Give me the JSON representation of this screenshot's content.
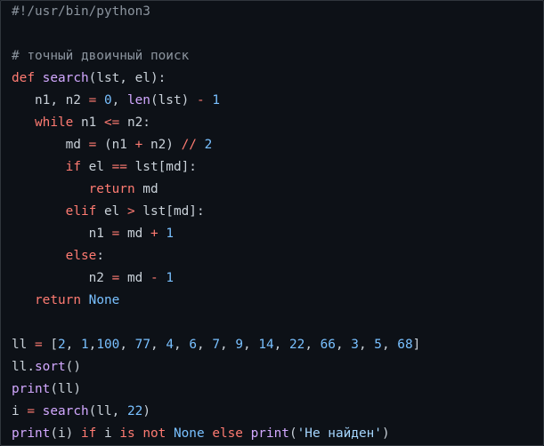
{
  "editor": {
    "language": "python",
    "colors": {
      "background": "#0d1117",
      "text": "#c9d1d9",
      "comment": "#8b949e",
      "keyword": "#ff7b72",
      "function": "#d2a8ff",
      "number": "#79c0ff",
      "string": "#a5d6ff"
    },
    "lines": [
      {
        "tokens": [
          {
            "t": "comment",
            "v": "#!/usr/bin/python3"
          }
        ]
      },
      {
        "tokens": []
      },
      {
        "tokens": [
          {
            "t": "comment",
            "v": "# точный двоичный поиск"
          }
        ]
      },
      {
        "tokens": [
          {
            "t": "keyword",
            "v": "def"
          },
          {
            "t": "text",
            "v": " "
          },
          {
            "t": "func",
            "v": "search"
          },
          {
            "t": "text",
            "v": "(lst, el):"
          }
        ]
      },
      {
        "tokens": [
          {
            "t": "text",
            "v": "   n1, n2 "
          },
          {
            "t": "op",
            "v": "="
          },
          {
            "t": "text",
            "v": " "
          },
          {
            "t": "number",
            "v": "0"
          },
          {
            "t": "text",
            "v": ", "
          },
          {
            "t": "builtin",
            "v": "len"
          },
          {
            "t": "text",
            "v": "(lst) "
          },
          {
            "t": "op",
            "v": "-"
          },
          {
            "t": "text",
            "v": " "
          },
          {
            "t": "number",
            "v": "1"
          }
        ]
      },
      {
        "tokens": [
          {
            "t": "text",
            "v": "   "
          },
          {
            "t": "keyword",
            "v": "while"
          },
          {
            "t": "text",
            "v": " n1 "
          },
          {
            "t": "op",
            "v": "<="
          },
          {
            "t": "text",
            "v": " n2:"
          }
        ]
      },
      {
        "tokens": [
          {
            "t": "text",
            "v": "       md "
          },
          {
            "t": "op",
            "v": "="
          },
          {
            "t": "text",
            "v": " (n1 "
          },
          {
            "t": "op",
            "v": "+"
          },
          {
            "t": "text",
            "v": " n2) "
          },
          {
            "t": "op",
            "v": "//"
          },
          {
            "t": "text",
            "v": " "
          },
          {
            "t": "number",
            "v": "2"
          }
        ]
      },
      {
        "tokens": [
          {
            "t": "text",
            "v": "       "
          },
          {
            "t": "keyword",
            "v": "if"
          },
          {
            "t": "text",
            "v": " el "
          },
          {
            "t": "op",
            "v": "=="
          },
          {
            "t": "text",
            "v": " lst[md]:"
          }
        ]
      },
      {
        "tokens": [
          {
            "t": "text",
            "v": "          "
          },
          {
            "t": "keyword",
            "v": "return"
          },
          {
            "t": "text",
            "v": " md"
          }
        ]
      },
      {
        "tokens": [
          {
            "t": "text",
            "v": "       "
          },
          {
            "t": "keyword",
            "v": "elif"
          },
          {
            "t": "text",
            "v": " el "
          },
          {
            "t": "op",
            "v": ">"
          },
          {
            "t": "text",
            "v": " lst[md]:"
          }
        ]
      },
      {
        "tokens": [
          {
            "t": "text",
            "v": "          n1 "
          },
          {
            "t": "op",
            "v": "="
          },
          {
            "t": "text",
            "v": " md "
          },
          {
            "t": "op",
            "v": "+"
          },
          {
            "t": "text",
            "v": " "
          },
          {
            "t": "number",
            "v": "1"
          }
        ]
      },
      {
        "tokens": [
          {
            "t": "text",
            "v": "       "
          },
          {
            "t": "keyword",
            "v": "else"
          },
          {
            "t": "text",
            "v": ":"
          }
        ]
      },
      {
        "tokens": [
          {
            "t": "text",
            "v": "          n2 "
          },
          {
            "t": "op",
            "v": "="
          },
          {
            "t": "text",
            "v": " md "
          },
          {
            "t": "op",
            "v": "-"
          },
          {
            "t": "text",
            "v": " "
          },
          {
            "t": "number",
            "v": "1"
          }
        ]
      },
      {
        "tokens": [
          {
            "t": "text",
            "v": "   "
          },
          {
            "t": "keyword",
            "v": "return"
          },
          {
            "t": "text",
            "v": " "
          },
          {
            "t": "const",
            "v": "None"
          }
        ]
      },
      {
        "tokens": []
      },
      {
        "tokens": [
          {
            "t": "text",
            "v": "ll "
          },
          {
            "t": "op",
            "v": "="
          },
          {
            "t": "text",
            "v": " ["
          },
          {
            "t": "number",
            "v": "2"
          },
          {
            "t": "text",
            "v": ", "
          },
          {
            "t": "number",
            "v": "1"
          },
          {
            "t": "text",
            "v": ","
          },
          {
            "t": "number",
            "v": "100"
          },
          {
            "t": "text",
            "v": ", "
          },
          {
            "t": "number",
            "v": "77"
          },
          {
            "t": "text",
            "v": ", "
          },
          {
            "t": "number",
            "v": "4"
          },
          {
            "t": "text",
            "v": ", "
          },
          {
            "t": "number",
            "v": "6"
          },
          {
            "t": "text",
            "v": ", "
          },
          {
            "t": "number",
            "v": "7"
          },
          {
            "t": "text",
            "v": ", "
          },
          {
            "t": "number",
            "v": "9"
          },
          {
            "t": "text",
            "v": ", "
          },
          {
            "t": "number",
            "v": "14"
          },
          {
            "t": "text",
            "v": ", "
          },
          {
            "t": "number",
            "v": "22"
          },
          {
            "t": "text",
            "v": ", "
          },
          {
            "t": "number",
            "v": "66"
          },
          {
            "t": "text",
            "v": ", "
          },
          {
            "t": "number",
            "v": "3"
          },
          {
            "t": "text",
            "v": ", "
          },
          {
            "t": "number",
            "v": "5"
          },
          {
            "t": "text",
            "v": ", "
          },
          {
            "t": "number",
            "v": "68"
          },
          {
            "t": "text",
            "v": "]"
          }
        ]
      },
      {
        "tokens": [
          {
            "t": "text",
            "v": "ll."
          },
          {
            "t": "func",
            "v": "sort"
          },
          {
            "t": "text",
            "v": "()"
          }
        ]
      },
      {
        "tokens": [
          {
            "t": "builtin",
            "v": "print"
          },
          {
            "t": "text",
            "v": "(ll)"
          }
        ]
      },
      {
        "tokens": [
          {
            "t": "text",
            "v": "i "
          },
          {
            "t": "op",
            "v": "="
          },
          {
            "t": "text",
            "v": " "
          },
          {
            "t": "func",
            "v": "search"
          },
          {
            "t": "text",
            "v": "(ll, "
          },
          {
            "t": "number",
            "v": "22"
          },
          {
            "t": "text",
            "v": ")"
          }
        ]
      },
      {
        "tokens": [
          {
            "t": "builtin",
            "v": "print"
          },
          {
            "t": "text",
            "v": "(i) "
          },
          {
            "t": "keyword",
            "v": "if"
          },
          {
            "t": "text",
            "v": " i "
          },
          {
            "t": "keyword",
            "v": "is"
          },
          {
            "t": "text",
            "v": " "
          },
          {
            "t": "keyword",
            "v": "not"
          },
          {
            "t": "text",
            "v": " "
          },
          {
            "t": "const",
            "v": "None"
          },
          {
            "t": "text",
            "v": " "
          },
          {
            "t": "keyword",
            "v": "else"
          },
          {
            "t": "text",
            "v": " "
          },
          {
            "t": "builtin",
            "v": "print"
          },
          {
            "t": "text",
            "v": "("
          },
          {
            "t": "string",
            "v": "'Не найден'"
          },
          {
            "t": "text",
            "v": ")"
          }
        ]
      }
    ]
  }
}
